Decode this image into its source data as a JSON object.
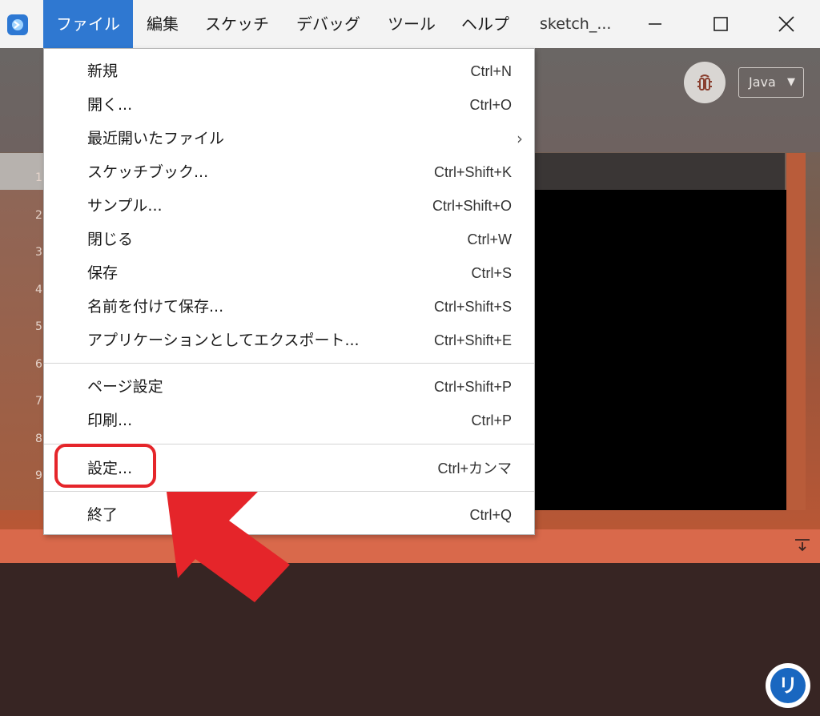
{
  "menubar": {
    "items": [
      {
        "label": "ファイル",
        "active": true
      },
      {
        "label": "編集"
      },
      {
        "label": "スケッチ"
      },
      {
        "label": "デバッグ"
      },
      {
        "label": "ツール"
      },
      {
        "label": "ヘルプ"
      }
    ],
    "window_title": "sketch_..."
  },
  "toolbar": {
    "mode": "Java",
    "mode_arrow": "▼"
  },
  "editor": {
    "line_numbers": [
      "1",
      "2",
      "3",
      "4",
      "5",
      "6",
      "7",
      "8",
      "9"
    ]
  },
  "file_menu": {
    "groups": [
      [
        {
          "label": "新規",
          "shortcut": "Ctrl+N"
        },
        {
          "label": "開く...",
          "shortcut": "Ctrl+O"
        },
        {
          "label": "最近開いたファイル",
          "submenu": "›"
        },
        {
          "label": "スケッチブック...",
          "shortcut": "Ctrl+Shift+K"
        },
        {
          "label": "サンプル...",
          "shortcut": "Ctrl+Shift+O"
        },
        {
          "label": "閉じる",
          "shortcut": "Ctrl+W"
        },
        {
          "label": "保存",
          "shortcut": "Ctrl+S"
        },
        {
          "label": "名前を付けて保存...",
          "shortcut": "Ctrl+Shift+S"
        },
        {
          "label": "アプリケーションとしてエクスポート...",
          "shortcut": "Ctrl+Shift+E"
        }
      ],
      [
        {
          "label": "ページ設定",
          "shortcut": "Ctrl+Shift+P"
        },
        {
          "label": "印刷...",
          "shortcut": "Ctrl+P"
        }
      ],
      [
        {
          "label": "設定...",
          "shortcut": "Ctrl+カンマ"
        }
      ],
      [
        {
          "label": "終了",
          "shortcut": "Ctrl+Q"
        }
      ]
    ]
  },
  "badge": {
    "glyph": "リ"
  },
  "colors": {
    "menu_active": "#2f78d1",
    "annotation_red": "#e5252a",
    "console_bg": "#372523",
    "console_header": "#d9694b"
  }
}
